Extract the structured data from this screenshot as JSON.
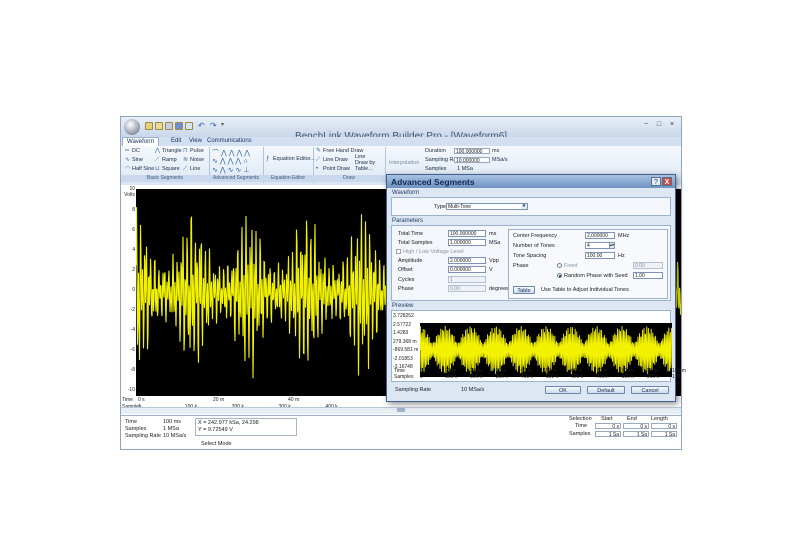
{
  "app": {
    "title": "BenchLink Waveform Builder Pro - [Waveform6]",
    "window_controls": [
      "−",
      "□",
      "×"
    ]
  },
  "tabs": [
    {
      "label": "Waveform",
      "active": true
    },
    {
      "label": "Edit",
      "active": false
    },
    {
      "label": "View",
      "active": false
    },
    {
      "label": "Communications",
      "active": false
    }
  ],
  "ribbon": {
    "basic": [
      "DC",
      "Triangle",
      "Pulse",
      "Sine",
      "Ramp",
      "Noise",
      "Half Sine",
      "Square",
      "Line"
    ],
    "basic_group": "Basic Segments",
    "advanced_group": "Advanced Segments",
    "equation_editor": "Equation Editor...",
    "equation_group": "Equation Editor",
    "draw": [
      "Free Hand Draw",
      "Line Draw",
      "Point Draw"
    ],
    "line_draw_table": "Line Draw by Table...",
    "draw_group": "Draw",
    "interpolation": "Interpolation",
    "duration_label": "Duration",
    "duration_value": "100.000000",
    "duration_unit": "ms",
    "sampling_rate_label": "Sampling Rate",
    "sampling_rate_value": "10.000000",
    "sampling_rate_unit": "MSa/s",
    "samples_label": "Samples",
    "samples_value": "1 MSa"
  },
  "plot": {
    "y_unit_top": "10",
    "y_unit_label": "Volts",
    "y_ticks": [
      "8",
      "6",
      "4",
      "2",
      "0",
      "-2",
      "-4",
      "-6",
      "-8",
      "-10"
    ],
    "x_row_label_time": "Time",
    "x_row_label_samples": "Samples",
    "x_time_ticks": [
      "0 s",
      "20 m",
      "40 m"
    ],
    "x_sample_ticks": [
      "1",
      "100 k",
      "200 k",
      "300 k",
      "400 k"
    ],
    "trace_color": "#f2f200"
  },
  "status": {
    "time_label": "Time",
    "time_value": "100 ms",
    "samples_label": "Samples",
    "samples_value": "1 MSa",
    "sampling_rate_label": "Sampling Rate",
    "sampling_rate_value": "10 MSa/s",
    "cursor_x": "X = 242.977 kSa, 24.298",
    "cursor_y": "Y = 9.72549 V",
    "select_mode": "Select Mode",
    "selection_label": "Selection",
    "start_label": "Start",
    "end_label": "End",
    "length_label": "Length",
    "row_time": "Time",
    "row_samples": "Samples",
    "time_start": "0 s",
    "time_end": "0 s",
    "time_length": "0 s",
    "samples_start": "1 Sa",
    "samples_end": "1 Sa",
    "samples_length": "1 Sa"
  },
  "dialog": {
    "title": "Advanced Segments",
    "help_button": "?",
    "close_button": "X",
    "waveform_group": "Waveform",
    "type_label": "Type:",
    "type_value": "Multi-Tone",
    "parameters_group": "Parameters",
    "total_time_label": "Total Time",
    "total_time_value": "100.000000",
    "total_time_unit": "ms",
    "total_samples_label": "Total Samples",
    "total_samples_value": "1.000000",
    "total_samples_unit": "MSa",
    "hl_voltage_label": "High / Low Voltage Level",
    "amplitude_label": "Amplitude",
    "amplitude_value": "2.000000",
    "amplitude_unit": "Vpp",
    "offset_label": "Offset",
    "offset_value": "0.000000",
    "offset_unit": "V",
    "cycles_label": "Cycles",
    "cycles_value": "1",
    "phase_label": "Phase",
    "phase_value": "0.00",
    "phase_unit": "degrees",
    "center_freq_label": "Center Frequency",
    "center_freq_value": "2.000000",
    "center_freq_unit": "MHz",
    "num_tones_label": "Number of Tones",
    "num_tones_value": "4",
    "tone_spacing_label": "Tone Spacing",
    "tone_spacing_value": "100.00",
    "tone_spacing_unit": "Hz",
    "tone_phase_label": "Phase",
    "fixed_label": "Fixed",
    "fixed_value": "0.00",
    "random_label": "Random Phase with Seed",
    "random_value": "1.00",
    "table_button": "Table",
    "table_hint": "Use Table to Adjust Individual Tones",
    "preview_group": "Preview",
    "preview_y": [
      "3.728252",
      "2.57722",
      "1.4283",
      "279.368 m",
      "-869.581 m",
      "-2.01853",
      "-3.16748"
    ],
    "preview_x_time_label": "Time",
    "preview_x_samples_label": "Samples",
    "preview_x_time": [
      "0 s",
      "10 m",
      "20 m",
      "30 m",
      "40 m",
      "50 m",
      "60 m",
      "70 m",
      "80 m",
      "90 m",
      "100 m"
    ],
    "preview_x_samples": [
      "1",
      "100 k",
      "200 k",
      "300 k",
      "400 k",
      "500 k",
      "600 k",
      "700 k",
      "800 k",
      "900 k",
      "1 M"
    ],
    "sampling_rate_label": "Sampling Rate",
    "sampling_rate_value": "10 MSa/s",
    "ok_button": "OK",
    "default_button": "Default",
    "cancel_button": "Cancel"
  }
}
